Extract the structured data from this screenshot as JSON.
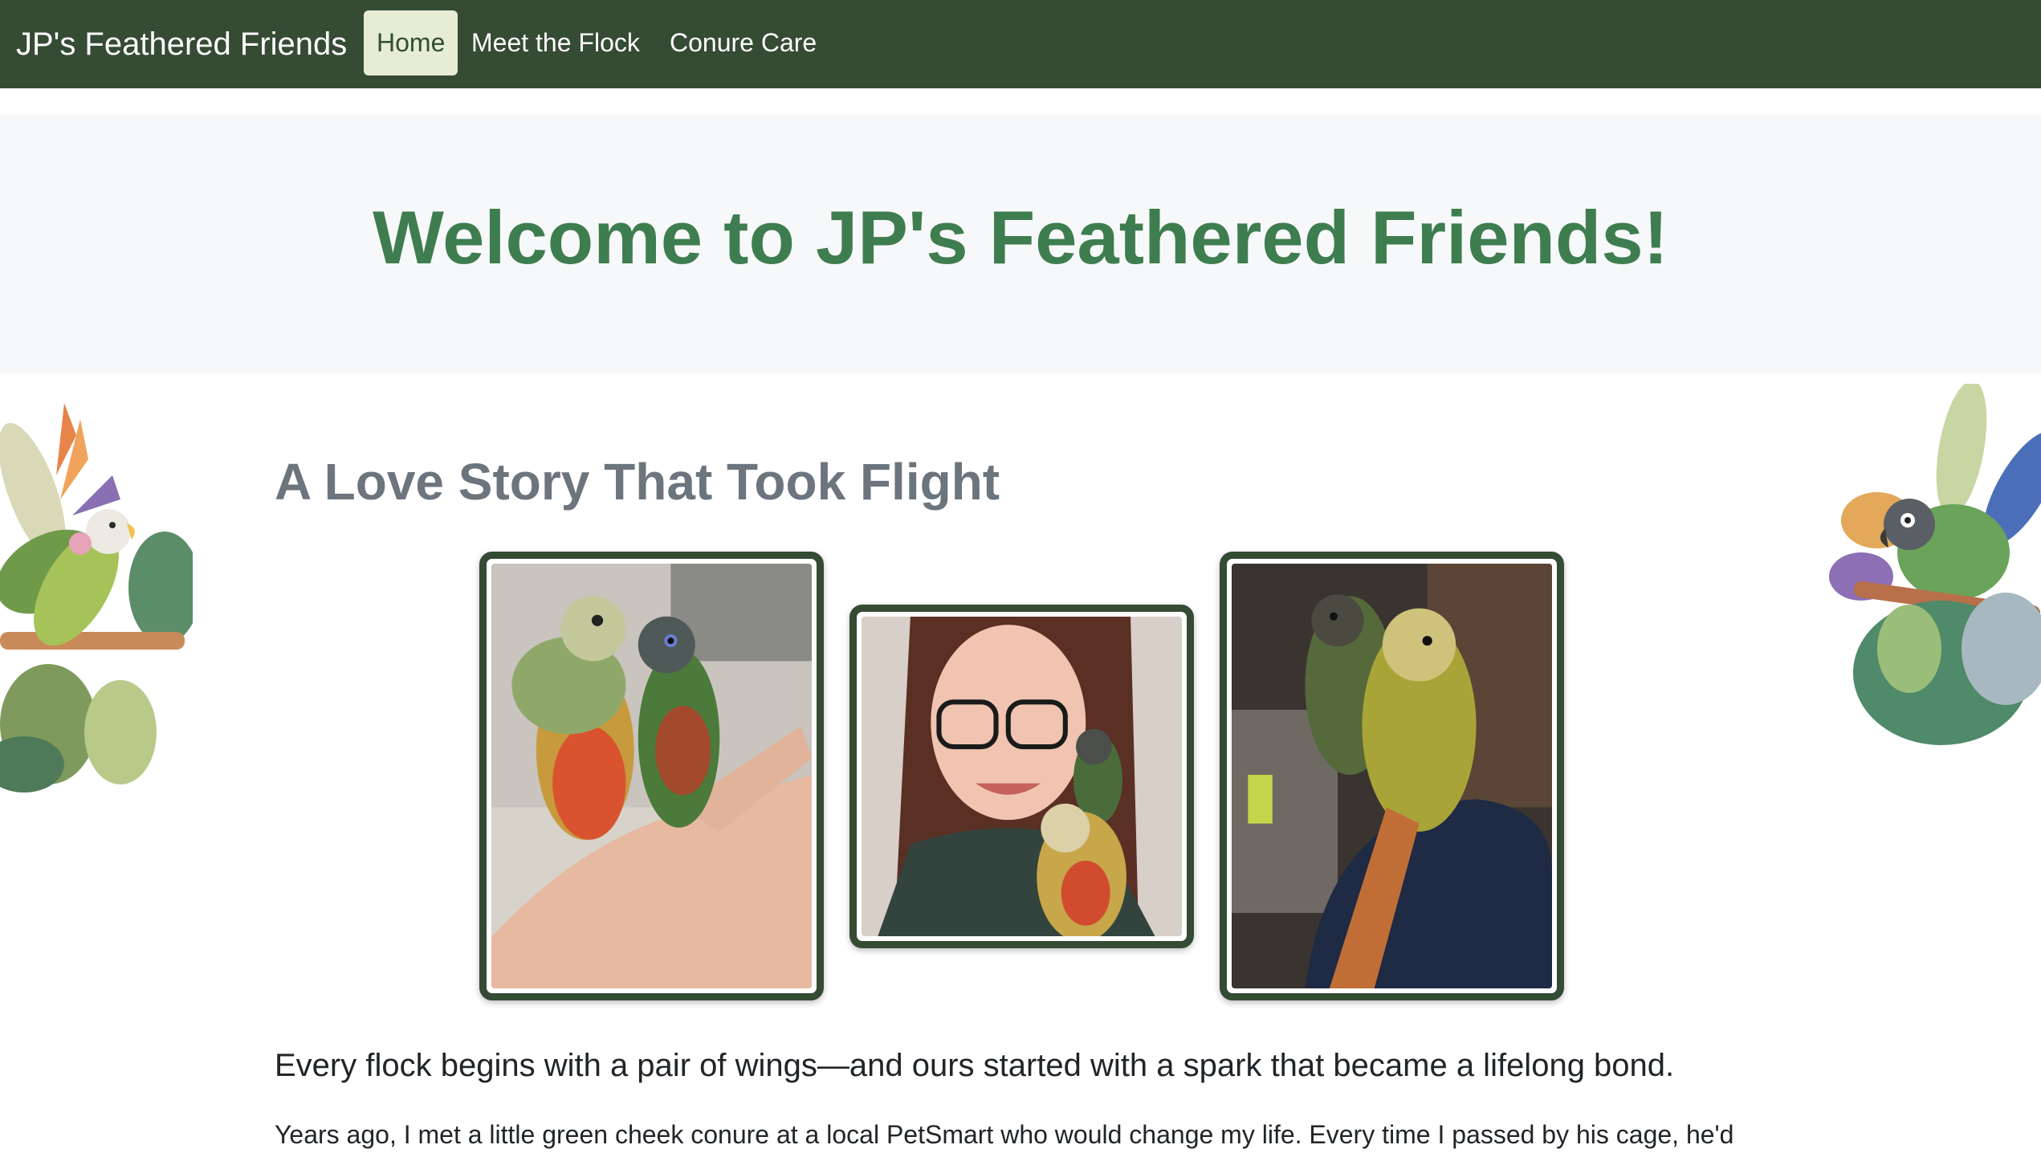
{
  "navbar": {
    "brand": "JP's Feathered Friends",
    "links": [
      {
        "label": "Home",
        "active": true
      },
      {
        "label": "Meet the Flock",
        "active": false
      },
      {
        "label": "Conure Care",
        "active": false
      }
    ],
    "background": "#354b34",
    "active_background": "#e7ecd4"
  },
  "hero": {
    "title": "Welcome to JP's Feathered Friends!",
    "title_color": "#3e7d4f"
  },
  "story": {
    "heading": "A Love Story That Took Flight",
    "photos": [
      {
        "name": "photo-two-conures-on-hand"
      },
      {
        "name": "photo-selfie-with-conures"
      },
      {
        "name": "photo-two-conures-on-shoulder"
      }
    ],
    "lead": "Every flock begins with a pair of wings—and ours started with a spark that became a lifelong bond.",
    "body": "Years ago, I met a little green cheek conure at a local PetSmart who would change my life. Every time I passed by his cage, he'd"
  },
  "decorations": {
    "left": "parrot-with-tropical-leaves-illustration",
    "right": "parrot-with-tropical-leaves-illustration"
  }
}
